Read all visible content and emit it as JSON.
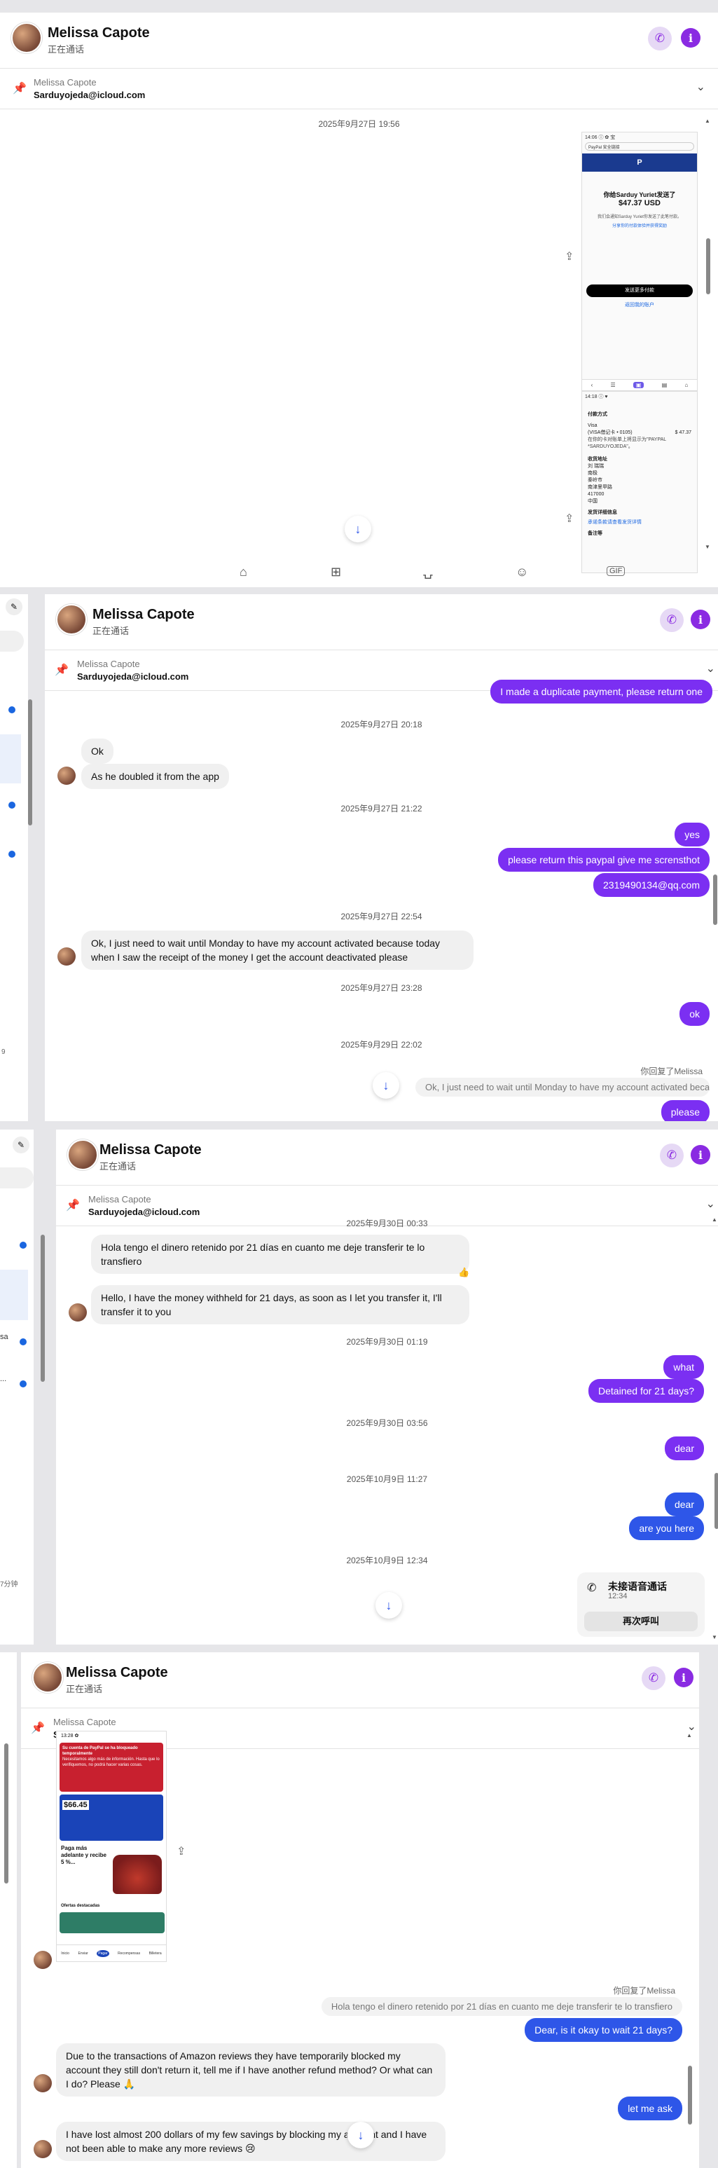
{
  "contact": {
    "name": "Melissa Capote",
    "status": "正在通话"
  },
  "pinned": {
    "name": "Melissa Capote",
    "email": "Sarduyojeda@icloud.com"
  },
  "frame1": {
    "timestamp": "2025年9月27日 19:56",
    "screenshot1": {
      "status_bar": "14:06 ⓘ ✿ 宝",
      "app_bar": "PayPal 安全链接",
      "sender_line": "你给Sarduy Yuriet发送了",
      "amount": "$47.37 USD",
      "note_line": "我们会通知Sarduy Yuriet你发送了此笔付款。",
      "link": "分享你的付款体验并获得奖励",
      "button": "发送更多付款",
      "second_link": "返回我的账户"
    },
    "screenshot2": {
      "status_bar": "14:18 ⓘ ♥",
      "section1": "付款方式",
      "visa": "Visa",
      "visa_detail": "(VISA借记卡 • 0105)",
      "visa_note": "在你的卡对账单上将显示为\"PAYPAL *SARDUYOJEDA\"。",
      "amount": "$ 47.37",
      "section2": "收货地址",
      "address": [
        "刘 瑞瑞",
        "南极",
        "秦岭市",
        "南津里甲路",
        "417000",
        "中国"
      ],
      "section3": "发货详细信息",
      "link": "承诺条款请查看发货详情",
      "section4": "备注等"
    },
    "toolbar": [
      "home-icon",
      "add-photo-icon",
      "cart-icon",
      "face-icon",
      "gif-icon"
    ]
  },
  "frame2": {
    "top_bubble": "I made a duplicate payment, please return one",
    "ts1": "2025年9月27日 20:18",
    "in1": "Ok",
    "in2": "As he doubled it from the app",
    "ts2": "2025年9月27日 21:22",
    "out1": "yes",
    "out2": "please return this paypal give me scrensthot",
    "out3": "2319490134@qq.com",
    "ts3": "2025年9月27日 22:54",
    "in3": "Ok, I just need to wait until Monday to have my account activated because today when I saw the receipt of the money I get the account deactivated please",
    "ts4": "2025年9月27日 23:28",
    "out4": "ok",
    "ts5": "2025年9月29日 22:02",
    "reply_hint": "你回复了Melissa",
    "quote": "Ok, I just need to wait until Monday to have my account activated becaus...",
    "out5": "please",
    "sidebar_footer": "9"
  },
  "frame3": {
    "ts1": "2025年9月30日 00:33",
    "in1": "Hola tengo el dinero retenido por 21 días en cuanto me deje transferir te lo transfiero",
    "reaction": "👍",
    "in2": "Hello, I have the money withheld for 21 days, as soon as I let you transfer it, I'll transfer it to you",
    "ts2": "2025年9月30日 01:19",
    "out1": "what",
    "out2": "Detained for 21 days?",
    "ts3": "2025年9月30日 03:56",
    "out3": "dear",
    "ts4": "2025年10月9日 11:27",
    "out4": "dear",
    "out5": "are you here",
    "ts5": "2025年10月9日 12:34",
    "missed_call": {
      "title": "未接语音通话",
      "time": "12:34",
      "button": "再次呼叫"
    },
    "sidebar_a": "sa",
    "sidebar_b": "...",
    "sidebar_footer": "7分钟"
  },
  "frame4": {
    "screenshot": {
      "time": "13:28 ✿",
      "alert": "Su cuenta de PayPal se ha bloqueado temporalmente",
      "alert_detail": "Necesitamos algo más de información. Hasta que lo verifiquemos, no podrá hacer varias cosas.",
      "balance": "$66.45",
      "promo_title": "Paga más adelante y recibe 5 %...",
      "offers": "Ofertas destacadas",
      "tabs": [
        "Inicio",
        "Enviar",
        "Pagar",
        "Recompensas",
        "Billetera"
      ]
    },
    "reply_hint": "你回复了Melissa",
    "quote": "Hola tengo el dinero retenido por 21 días en cuanto me deje transferir te lo transfiero",
    "out1": "Dear, is it okay to wait 21 days?",
    "in1": "Due to the transactions of Amazon reviews they have temporarily blocked my account they still don't return it, tell me if I have another refund method? Or what can I do? Please 🙏",
    "out2": "let me ask",
    "in2": "I have lost almost 200 dollars of my few savings by blocking my account and I have not been able to make any more reviews 😢"
  }
}
